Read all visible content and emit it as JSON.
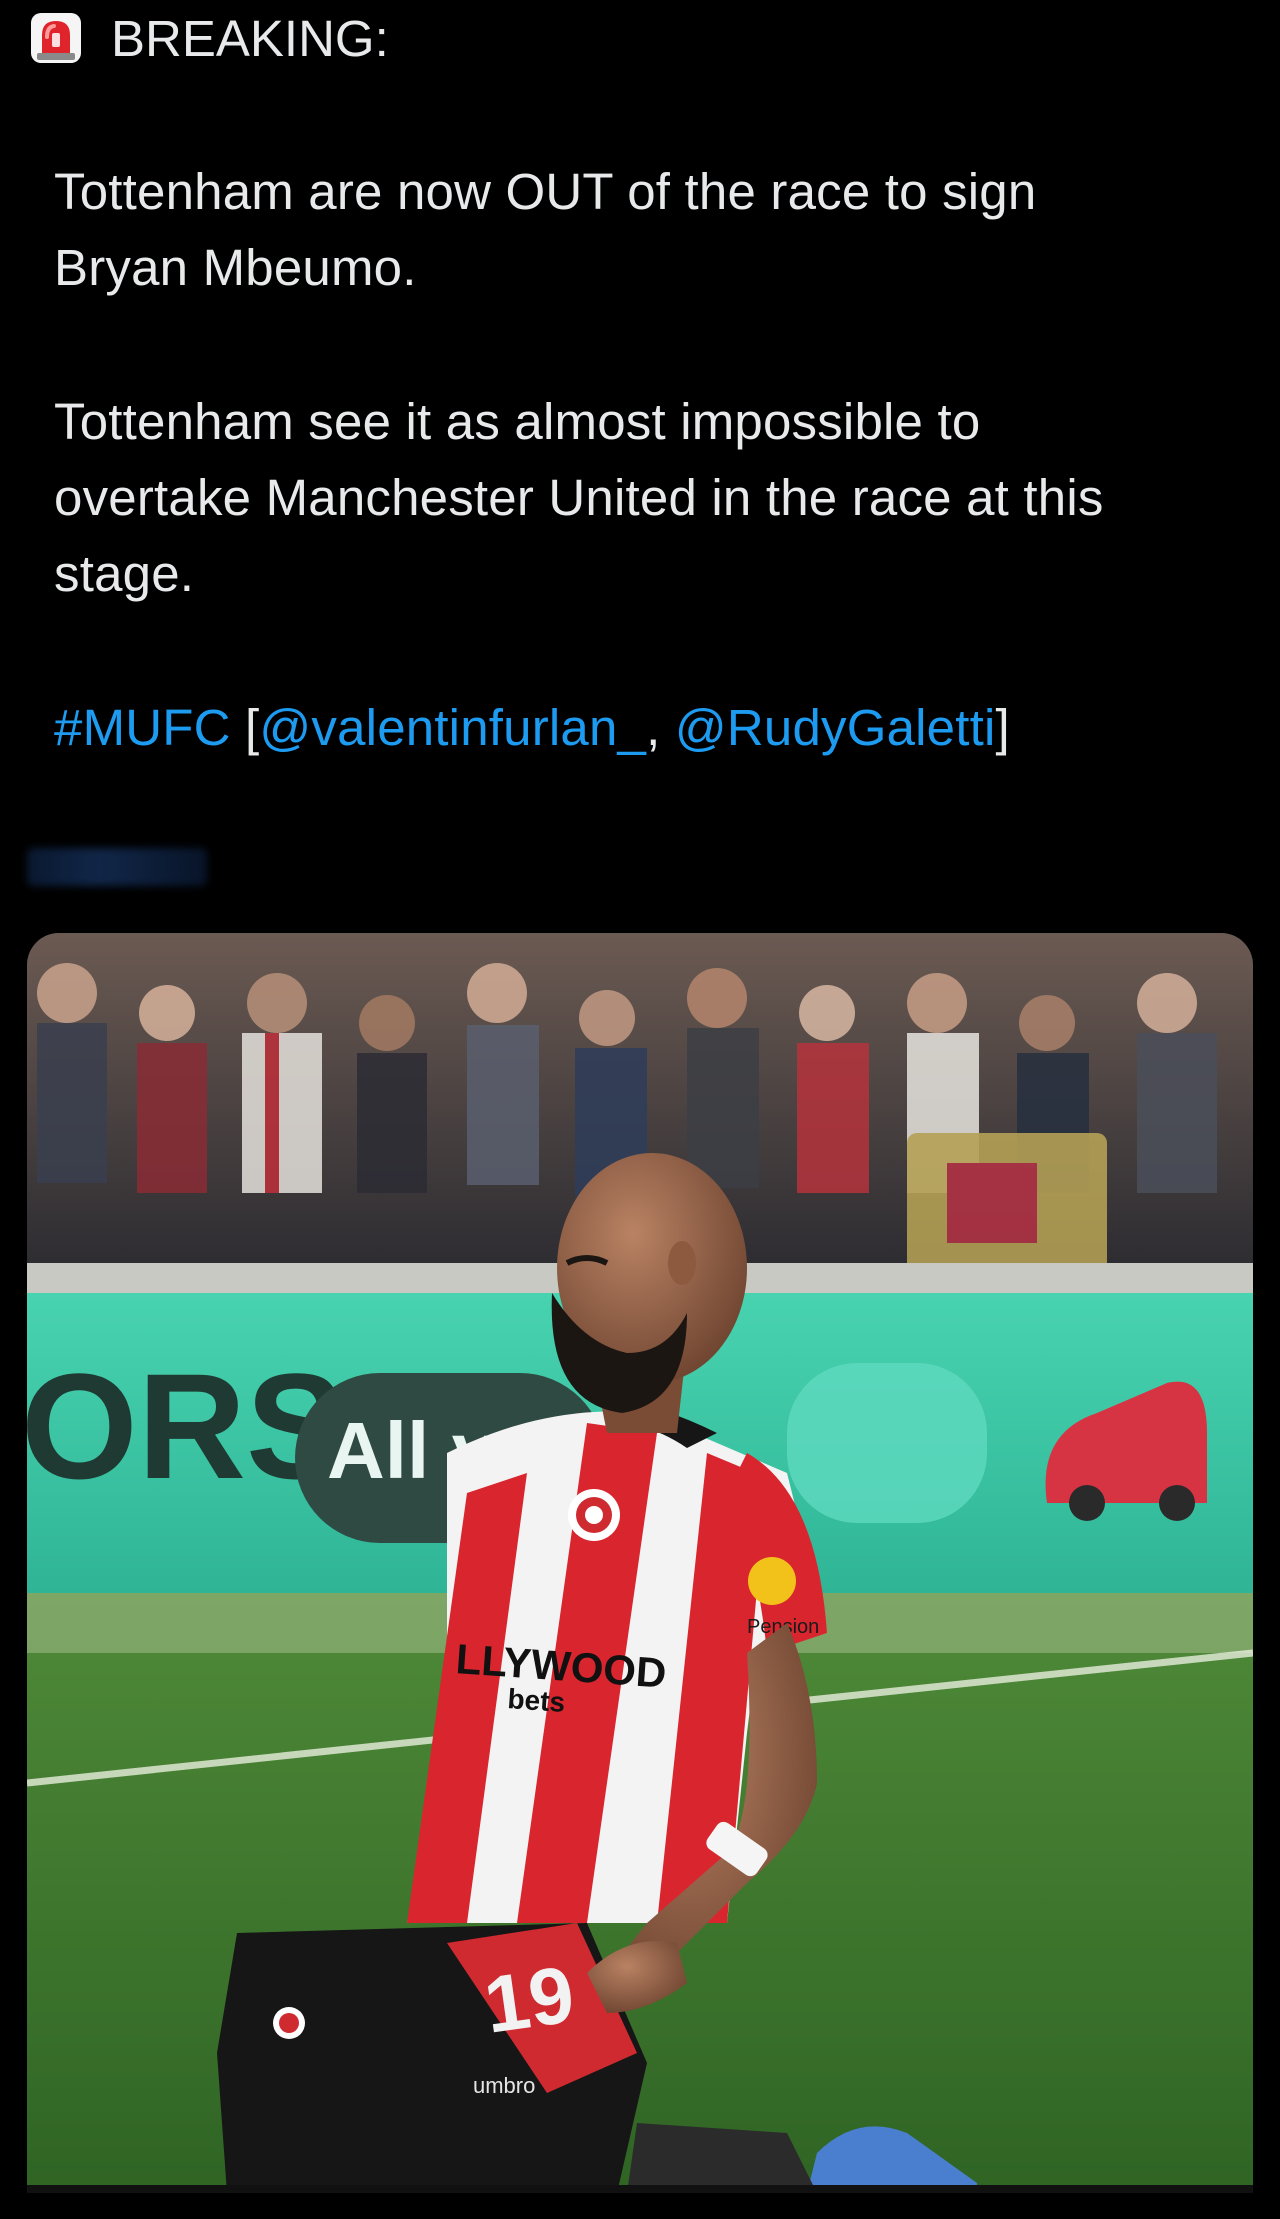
{
  "tweet": {
    "breaking_label": "BREAKING:",
    "siren_icon": "police-car-light-icon",
    "paragraph1_line1": "Tottenham are now OUT of the race to sign",
    "paragraph1_line2": "Bryan Mbeumo.",
    "paragraph2_line1": "Tottenham see it as almost impossible to",
    "paragraph2_line2": "overtake Manchester United in the race at this",
    "paragraph2_line3": "stage.",
    "hashtag": "#MUFC",
    "bracket_open": " [",
    "mention1": "@valentinfurlan_",
    "separator": ", ",
    "mention2": "@RudyGaletti",
    "bracket_close": "]"
  },
  "media": {
    "board_text_left": "ORS",
    "board_text_pill": "All you n",
    "shirt_sponsor_line1": "LLYWOOD",
    "shirt_sponsor_line2": "bets",
    "sleeve_text": "Pension",
    "shorts_number": "19",
    "shorts_brand": "umbro"
  },
  "colors": {
    "background": "#000000",
    "text": "#e7e9ea",
    "link": "#1d9bf0",
    "board_green": "#3fc9a8",
    "pitch_green": "#3f7a2e",
    "shirt_red": "#d9262e"
  }
}
